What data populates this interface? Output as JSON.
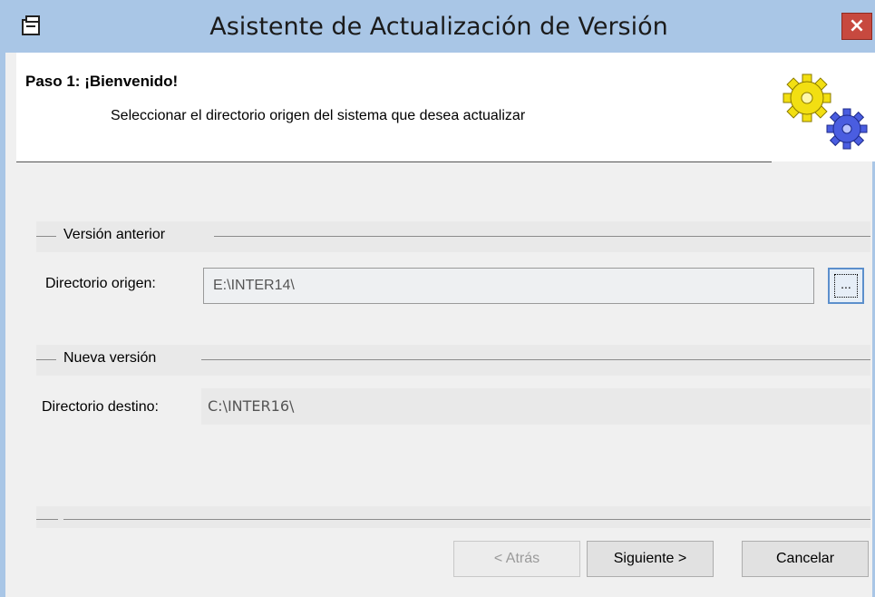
{
  "window": {
    "title": "Asistente de Actualización de Versión",
    "close_label": "×"
  },
  "header": {
    "step_title": "Paso 1: ¡Bienvenido!",
    "step_description": "Seleccionar el directorio origen del sistema que desea actualizar"
  },
  "previous_version": {
    "group_label": "Versión anterior",
    "origin_label": "Directorio origen:",
    "origin_value": "E:\\INTER14\\",
    "browse_label": "..."
  },
  "new_version": {
    "group_label": "Nueva versión",
    "dest_label": "Directorio destino:",
    "dest_value": "C:\\INTER16\\"
  },
  "buttons": {
    "back": "< Atrás",
    "next": "Siguiente >",
    "cancel": "Cancelar"
  },
  "colors": {
    "titlebar": "#a9c6e6",
    "close": "#c7493f",
    "gear_yellow": "#f2df12",
    "gear_blue": "#4a5de0"
  }
}
